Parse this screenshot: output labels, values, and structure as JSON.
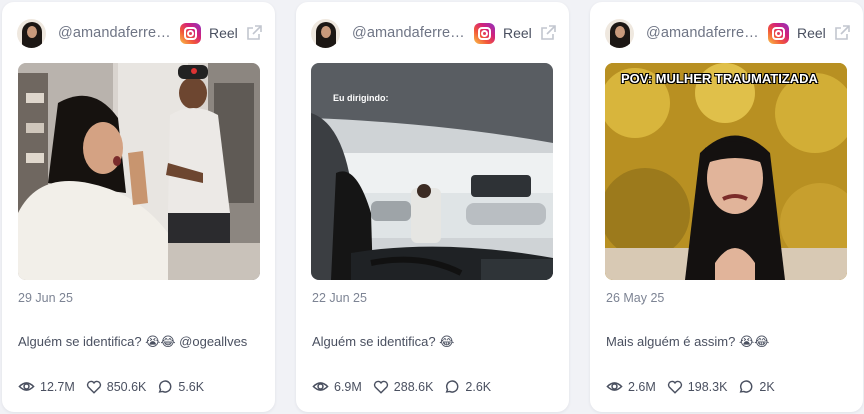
{
  "posts": [
    {
      "username": "@amandaferreira",
      "platform_icon": "instagram-icon",
      "type": "Reel",
      "date": "29 Jun 25",
      "caption": "Alguém se identifica? 😭😂 @ogeallves",
      "overlay_text": "",
      "views": "12.7M",
      "likes": "850.6K",
      "comments": "5.6K"
    },
    {
      "username": "@amandaferreira",
      "platform_icon": "instagram-icon",
      "type": "Reel",
      "date": "22 Jun 25",
      "caption": "Alguém se identifica? 😂",
      "overlay_text": "Eu dirigindo:",
      "views": "6.9M",
      "likes": "288.6K",
      "comments": "2.6K"
    },
    {
      "username": "@amandaferreira",
      "platform_icon": "instagram-icon",
      "type": "Reel",
      "date": "26 May 25",
      "caption": "Mais alguém é assim? 😭😂",
      "overlay_text": "POV: MULHER TRAUMATIZADA",
      "views": "2.6M",
      "likes": "198.3K",
      "comments": "2K"
    }
  ]
}
